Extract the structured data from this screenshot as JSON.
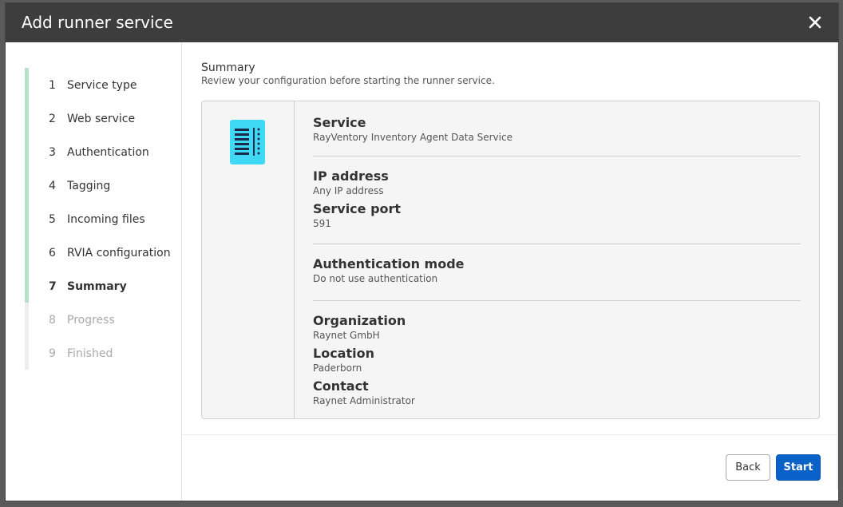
{
  "dialog": {
    "title": "Add runner service",
    "close_icon": "close-icon"
  },
  "steps": [
    {
      "num": "1",
      "label": "Service type",
      "state": "done"
    },
    {
      "num": "2",
      "label": "Web service",
      "state": "done"
    },
    {
      "num": "3",
      "label": "Authentication",
      "state": "done"
    },
    {
      "num": "4",
      "label": "Tagging",
      "state": "done"
    },
    {
      "num": "5",
      "label": "Incoming files",
      "state": "done"
    },
    {
      "num": "6",
      "label": "RVIA configuration",
      "state": "done"
    },
    {
      "num": "7",
      "label": "Summary",
      "state": "active"
    },
    {
      "num": "8",
      "label": "Progress",
      "state": "pending"
    },
    {
      "num": "9",
      "label": "Finished",
      "state": "pending"
    }
  ],
  "summary": {
    "title": "Summary",
    "subtitle": "Review your configuration before starting the runner service.",
    "icon": "document-list-icon",
    "service_label": "Service",
    "service_value": "RayVentory Inventory Agent Data Service",
    "ip_label": "IP address",
    "ip_value": "Any IP address",
    "port_label": "Service port",
    "port_value": "591",
    "auth_label": "Authentication mode",
    "auth_value": "Do not use authentication",
    "org_label": "Organization",
    "org_value": "Raynet GmbH",
    "location_label": "Location",
    "location_value": "Paderborn",
    "contact_label": "Contact",
    "contact_value": "Raynet Administrator"
  },
  "buttons": {
    "back": "Back",
    "start": "Start"
  },
  "colors": {
    "titlebar": "#3d3d3d",
    "step_done": "#b5e3c3",
    "primary": "#0a62c8",
    "icon_fill": "#3fd8f5"
  }
}
